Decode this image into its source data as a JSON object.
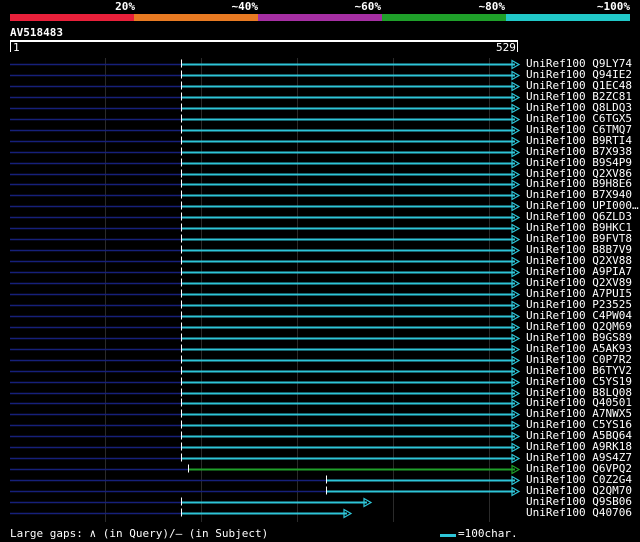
{
  "query": {
    "name": "AV518483",
    "start": "1",
    "end": "529",
    "length": 529
  },
  "legend": {
    "labels": [
      "20%",
      "~40%",
      "~60%",
      "~80%",
      "~100%"
    ],
    "colors": [
      "#e8203a",
      "#e87a22",
      "#a62fa3",
      "#1fa02a",
      "#21c8c8"
    ]
  },
  "footer": {
    "text": "Large gaps: ∧ (in Query)/— (in Subject)",
    "scale_text": "=100char."
  },
  "hits": [
    {
      "label": "UniRef100_Q9LY74",
      "start": 179,
      "end": 529,
      "color": "#2ec5d8"
    },
    {
      "label": "UniRef100_Q94IE2",
      "start": 179,
      "end": 529,
      "color": "#2ec5d8"
    },
    {
      "label": "UniRef100_Q1EC48",
      "start": 179,
      "end": 529,
      "color": "#2ec5d8"
    },
    {
      "label": "UniRef100_B2ZC81",
      "start": 179,
      "end": 529,
      "color": "#2ec5d8"
    },
    {
      "label": "UniRef100_Q8LDQ3",
      "start": 179,
      "end": 529,
      "color": "#2ec5d8"
    },
    {
      "label": "UniRef100_C6TGX5",
      "start": 179,
      "end": 529,
      "color": "#2ec5d8"
    },
    {
      "label": "UniRef100_C6TMQ7",
      "start": 179,
      "end": 529,
      "color": "#2ec5d8"
    },
    {
      "label": "UniRef100_B9RTI4",
      "start": 179,
      "end": 529,
      "color": "#2ec5d8"
    },
    {
      "label": "UniRef100_B7X938",
      "start": 179,
      "end": 529,
      "color": "#2ec5d8"
    },
    {
      "label": "UniRef100_B9S4P9",
      "start": 179,
      "end": 529,
      "color": "#2ec5d8"
    },
    {
      "label": "UniRef100_Q2XV86",
      "start": 179,
      "end": 529,
      "color": "#2ec5d8"
    },
    {
      "label": "UniRef100_B9H8E6",
      "start": 179,
      "end": 529,
      "color": "#2ec5d8"
    },
    {
      "label": "UniRef100_B7X940",
      "start": 179,
      "end": 529,
      "color": "#2ec5d8"
    },
    {
      "label": "UniRef100_UPI000…",
      "start": 179,
      "end": 529,
      "color": "#2ec5d8"
    },
    {
      "label": "UniRef100_Q6ZLD3",
      "start": 179,
      "end": 529,
      "color": "#2ec5d8"
    },
    {
      "label": "UniRef100_B9HKC1",
      "start": 179,
      "end": 529,
      "color": "#2ec5d8"
    },
    {
      "label": "UniRef100_B9FVT8",
      "start": 179,
      "end": 529,
      "color": "#2ec5d8"
    },
    {
      "label": "UniRef100_B8B7V9",
      "start": 179,
      "end": 529,
      "color": "#2ec5d8"
    },
    {
      "label": "UniRef100_Q2XV88",
      "start": 179,
      "end": 529,
      "color": "#2ec5d8"
    },
    {
      "label": "UniRef100_A9PIA7",
      "start": 179,
      "end": 529,
      "color": "#2ec5d8"
    },
    {
      "label": "UniRef100_Q2XV89",
      "start": 179,
      "end": 529,
      "color": "#2ec5d8"
    },
    {
      "label": "UniRef100_A7PUI5",
      "start": 179,
      "end": 529,
      "color": "#2ec5d8"
    },
    {
      "label": "UniRef100_P23525",
      "start": 179,
      "end": 529,
      "color": "#2ec5d8"
    },
    {
      "label": "UniRef100_C4PW04",
      "start": 179,
      "end": 529,
      "color": "#2ec5d8"
    },
    {
      "label": "UniRef100_Q2QM69",
      "start": 179,
      "end": 529,
      "color": "#2ec5d8"
    },
    {
      "label": "UniRef100_B9GS89",
      "start": 179,
      "end": 529,
      "color": "#2ec5d8"
    },
    {
      "label": "UniRef100_A5AK93",
      "start": 179,
      "end": 529,
      "color": "#2ec5d8"
    },
    {
      "label": "UniRef100_C0P7R2",
      "start": 179,
      "end": 529,
      "color": "#2ec5d8"
    },
    {
      "label": "UniRef100_B6TYV2",
      "start": 179,
      "end": 529,
      "color": "#2ec5d8"
    },
    {
      "label": "UniRef100_C5YS19",
      "start": 179,
      "end": 529,
      "color": "#2ec5d8"
    },
    {
      "label": "UniRef100_B8LQ08",
      "start": 179,
      "end": 529,
      "color": "#2ec5d8"
    },
    {
      "label": "UniRef100_Q40501",
      "start": 179,
      "end": 529,
      "color": "#2ec5d8"
    },
    {
      "label": "UniRef100_A7NWX5",
      "start": 179,
      "end": 529,
      "color": "#2ec5d8"
    },
    {
      "label": "UniRef100_C5YS16",
      "start": 179,
      "end": 529,
      "color": "#2ec5d8"
    },
    {
      "label": "UniRef100_A5BQ64",
      "start": 179,
      "end": 529,
      "color": "#2ec5d8"
    },
    {
      "label": "UniRef100_A9RK18",
      "start": 179,
      "end": 529,
      "color": "#2ec5d8"
    },
    {
      "label": "UniRef100_A9S4Z7",
      "start": 179,
      "end": 529,
      "color": "#2ec5d8"
    },
    {
      "label": "UniRef100_Q6VPQ2",
      "start": 186,
      "end": 529,
      "color": "#1fa02a"
    },
    {
      "label": "UniRef100_C0Z2G4",
      "start": 330,
      "end": 529,
      "color": "#2ec5d8"
    },
    {
      "label": "UniRef100_Q2QM70",
      "start": 330,
      "end": 529,
      "color": "#2ec5d8"
    },
    {
      "label": "UniRef100_Q9SB06",
      "start": 179,
      "end": 375,
      "color": "#2ec5d8"
    },
    {
      "label": "UniRef100_Q40706",
      "start": 179,
      "end": 354,
      "color": "#2ec5d8"
    }
  ]
}
